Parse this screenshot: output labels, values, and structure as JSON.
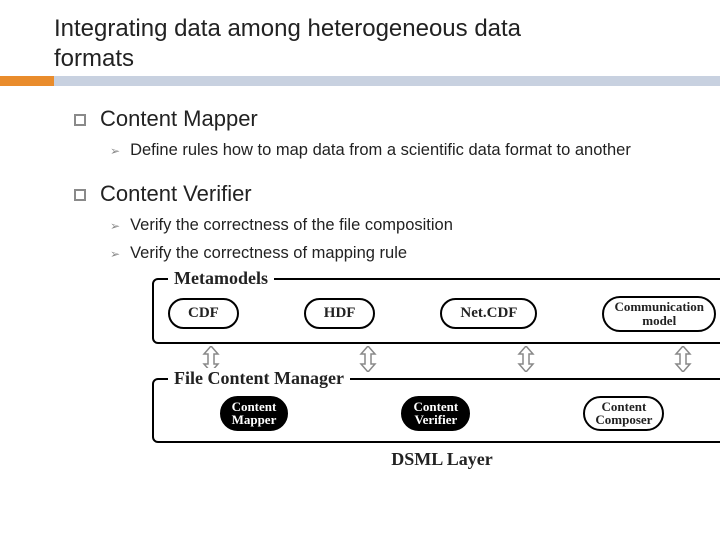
{
  "slide": {
    "title_line1": "Integrating data among heterogeneous data",
    "title_line2": "formats"
  },
  "bullets": {
    "item1": {
      "label": "Content Mapper",
      "sub1": "Define rules how to map data from a scientific data format to another"
    },
    "item2": {
      "label": "Content Verifier",
      "sub1": "Verify the correctness of the file composition",
      "sub2": "Verify the correctness of mapping rule"
    }
  },
  "diagram": {
    "box1_label": "Metamodels",
    "box1_items": [
      "CDF",
      "HDF",
      "Net.CDF",
      "Communication\nmodel"
    ],
    "box2_label": "File Content Manager",
    "box2_items": [
      "Content\nMapper",
      "Content\nVerifier",
      "Content\nComposer"
    ],
    "footer": "DSML Layer"
  }
}
